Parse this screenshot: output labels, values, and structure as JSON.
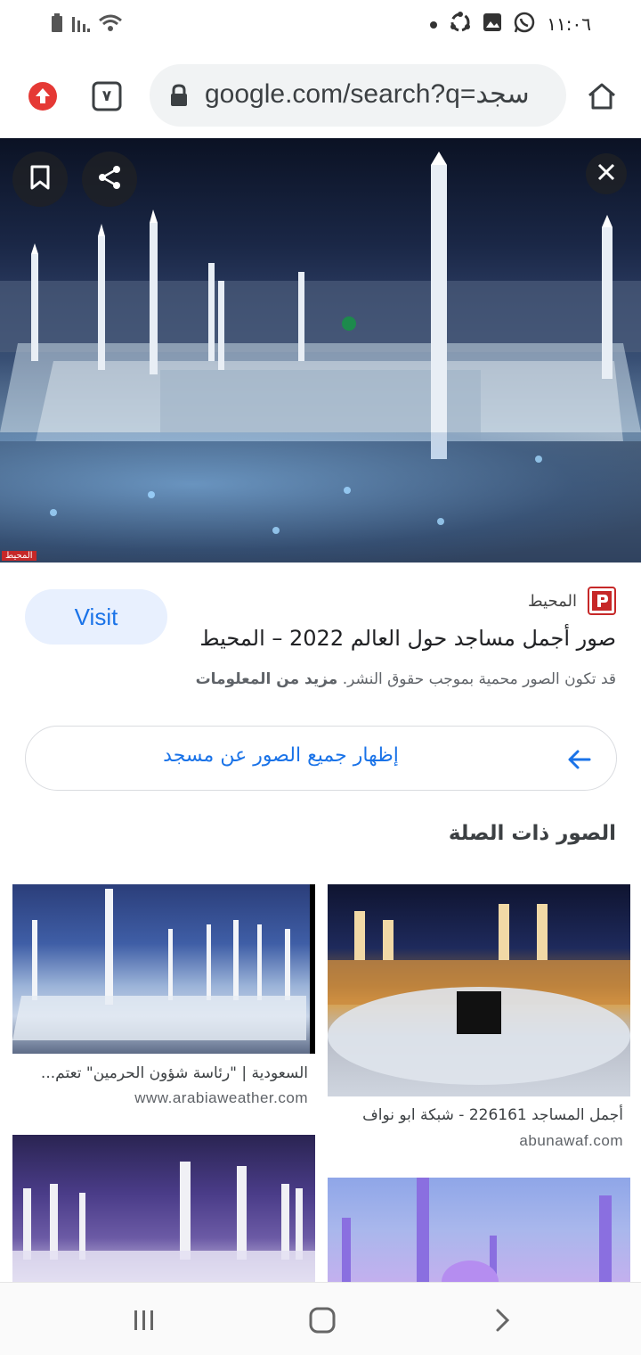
{
  "status_bar": {
    "time": "١١:٠٦",
    "icons": [
      "battery-icon",
      "signal-icon",
      "wifi-icon",
      "dot-icon",
      "sync-icon",
      "gallery-icon",
      "whatsapp-icon"
    ]
  },
  "toolbar": {
    "tab_count": "٧",
    "url": "google.com/search?q=سجد",
    "icons": [
      "upload-icon",
      "tabs-icon",
      "lock-icon",
      "home-icon"
    ]
  },
  "hero": {
    "watermark": "المحيط",
    "icons": [
      "bookmark-icon",
      "share-icon",
      "close-icon"
    ]
  },
  "result": {
    "source_name": "المحيط",
    "visit_label": "Visit",
    "title": "صور أجمل مساجد حول العالم 2022 – المحيط",
    "copyright_text": "قد تكون الصور محمية بموجب حقوق النشر.",
    "more_info": "مزيد من المعلومات",
    "show_all_label": "إظهار جميع الصور عن مسجد"
  },
  "related": {
    "heading": "الصور ذات الصلة",
    "items": [
      {
        "title": "أجمل المساجد 226161 - شبكة ابو نواف",
        "domain": "abunawaf.com"
      },
      {
        "title": "السعودية | \"رئاسة شؤون الحرمين\" تعتم...",
        "domain": "www.arabiaweather.com"
      }
    ]
  },
  "colors": {
    "accent": "#1a73e8",
    "visit_bg": "#e8f0fe",
    "url_pill": "#f1f3f4"
  },
  "navbar": {
    "icons": [
      "recents-icon",
      "home-nav-icon",
      "back-icon"
    ]
  }
}
